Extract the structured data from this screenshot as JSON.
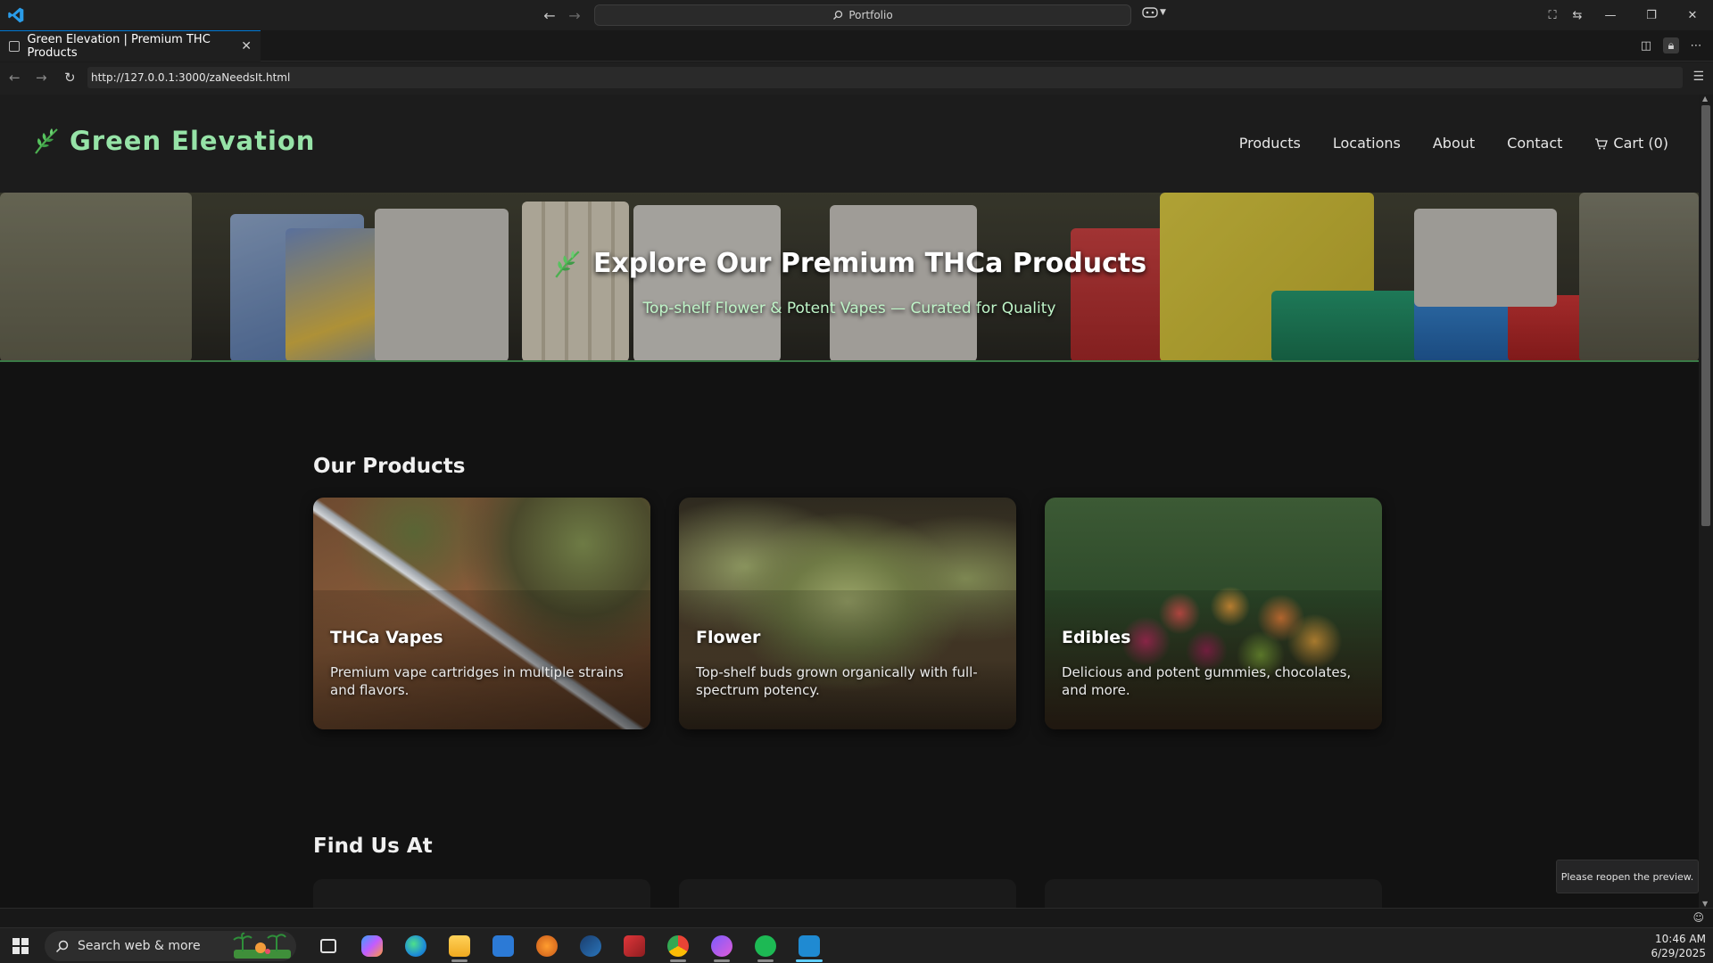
{
  "titlebar": {
    "command_center_text": "Portfolio",
    "icons": [
      "vscode-logo",
      "back-arrow",
      "forward-arrow",
      "search-icon",
      "copilot-icon",
      "layout-icon",
      "minimize",
      "restore",
      "close"
    ]
  },
  "tab": {
    "title": "Green Elevation | Premium THC Products",
    "close_glyph": "✕"
  },
  "browser": {
    "url": "http://127.0.0.1:3000/zaNeedsIt.html"
  },
  "site": {
    "brand": "Green Elevation",
    "nav": [
      {
        "label": "Products"
      },
      {
        "label": "Locations"
      },
      {
        "label": "About"
      },
      {
        "label": "Contact"
      },
      {
        "label": "Cart (0)"
      }
    ],
    "hero": {
      "title": "Explore Our Premium THCa Products",
      "subtitle": "Top-shelf Flower & Potent Vapes — Curated for Quality"
    },
    "products_section": {
      "title": "Our Products",
      "cards": [
        {
          "title": "THCa Vapes",
          "description": "Premium vape cartridges in multiple strains and flavors."
        },
        {
          "title": "Flower",
          "description": "Top-shelf buds grown organically with full-spectrum potency."
        },
        {
          "title": "Edibles",
          "description": "Delicious and potent gummies, chocolates, and more."
        }
      ]
    },
    "locations_section": {
      "title": "Find Us At"
    }
  },
  "toast": {
    "message": "Please reopen the preview."
  },
  "taskbar": {
    "search_placeholder": "Search web & more",
    "apps": [
      "task-view",
      "copilot",
      "edge",
      "file-explorer",
      "microsoft-store",
      "fl-studio",
      "steam",
      "angry-ip",
      "chrome",
      "discord",
      "spotify",
      "vscode"
    ],
    "time": "10:46 AM",
    "date": "6/29/2025"
  },
  "colors": {
    "brand_green": "#96e3a7",
    "hero_subtitle": "#bff5c8",
    "vscode_blue": "#0078d4",
    "taskbar_active": "#60cdff"
  }
}
